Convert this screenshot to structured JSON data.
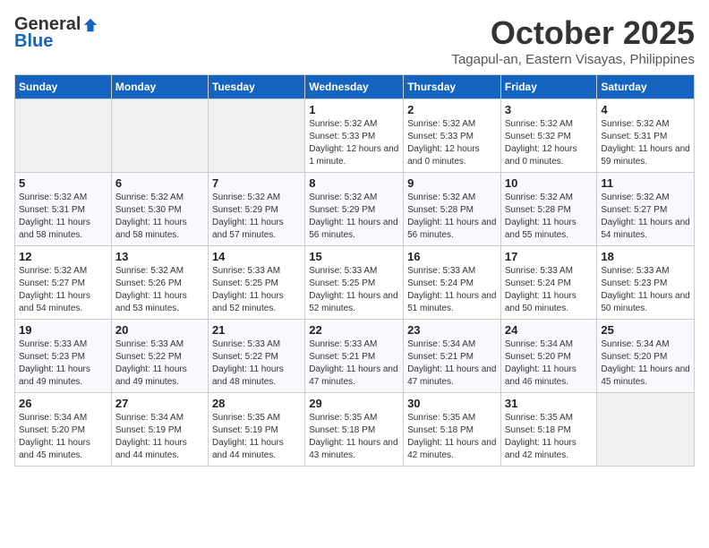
{
  "header": {
    "logo_general": "General",
    "logo_blue": "Blue",
    "month_title": "October 2025",
    "location": "Tagapul-an, Eastern Visayas, Philippines"
  },
  "columns": [
    "Sunday",
    "Monday",
    "Tuesday",
    "Wednesday",
    "Thursday",
    "Friday",
    "Saturday"
  ],
  "weeks": [
    [
      {
        "day": "",
        "info": ""
      },
      {
        "day": "",
        "info": ""
      },
      {
        "day": "",
        "info": ""
      },
      {
        "day": "1",
        "info": "Sunrise: 5:32 AM\nSunset: 5:33 PM\nDaylight: 12 hours and 1 minute."
      },
      {
        "day": "2",
        "info": "Sunrise: 5:32 AM\nSunset: 5:33 PM\nDaylight: 12 hours and 0 minutes."
      },
      {
        "day": "3",
        "info": "Sunrise: 5:32 AM\nSunset: 5:32 PM\nDaylight: 12 hours and 0 minutes."
      },
      {
        "day": "4",
        "info": "Sunrise: 5:32 AM\nSunset: 5:31 PM\nDaylight: 11 hours and 59 minutes."
      }
    ],
    [
      {
        "day": "5",
        "info": "Sunrise: 5:32 AM\nSunset: 5:31 PM\nDaylight: 11 hours and 58 minutes."
      },
      {
        "day": "6",
        "info": "Sunrise: 5:32 AM\nSunset: 5:30 PM\nDaylight: 11 hours and 58 minutes."
      },
      {
        "day": "7",
        "info": "Sunrise: 5:32 AM\nSunset: 5:29 PM\nDaylight: 11 hours and 57 minutes."
      },
      {
        "day": "8",
        "info": "Sunrise: 5:32 AM\nSunset: 5:29 PM\nDaylight: 11 hours and 56 minutes."
      },
      {
        "day": "9",
        "info": "Sunrise: 5:32 AM\nSunset: 5:28 PM\nDaylight: 11 hours and 56 minutes."
      },
      {
        "day": "10",
        "info": "Sunrise: 5:32 AM\nSunset: 5:28 PM\nDaylight: 11 hours and 55 minutes."
      },
      {
        "day": "11",
        "info": "Sunrise: 5:32 AM\nSunset: 5:27 PM\nDaylight: 11 hours and 54 minutes."
      }
    ],
    [
      {
        "day": "12",
        "info": "Sunrise: 5:32 AM\nSunset: 5:27 PM\nDaylight: 11 hours and 54 minutes."
      },
      {
        "day": "13",
        "info": "Sunrise: 5:32 AM\nSunset: 5:26 PM\nDaylight: 11 hours and 53 minutes."
      },
      {
        "day": "14",
        "info": "Sunrise: 5:33 AM\nSunset: 5:25 PM\nDaylight: 11 hours and 52 minutes."
      },
      {
        "day": "15",
        "info": "Sunrise: 5:33 AM\nSunset: 5:25 PM\nDaylight: 11 hours and 52 minutes."
      },
      {
        "day": "16",
        "info": "Sunrise: 5:33 AM\nSunset: 5:24 PM\nDaylight: 11 hours and 51 minutes."
      },
      {
        "day": "17",
        "info": "Sunrise: 5:33 AM\nSunset: 5:24 PM\nDaylight: 11 hours and 50 minutes."
      },
      {
        "day": "18",
        "info": "Sunrise: 5:33 AM\nSunset: 5:23 PM\nDaylight: 11 hours and 50 minutes."
      }
    ],
    [
      {
        "day": "19",
        "info": "Sunrise: 5:33 AM\nSunset: 5:23 PM\nDaylight: 11 hours and 49 minutes."
      },
      {
        "day": "20",
        "info": "Sunrise: 5:33 AM\nSunset: 5:22 PM\nDaylight: 11 hours and 49 minutes."
      },
      {
        "day": "21",
        "info": "Sunrise: 5:33 AM\nSunset: 5:22 PM\nDaylight: 11 hours and 48 minutes."
      },
      {
        "day": "22",
        "info": "Sunrise: 5:33 AM\nSunset: 5:21 PM\nDaylight: 11 hours and 47 minutes."
      },
      {
        "day": "23",
        "info": "Sunrise: 5:34 AM\nSunset: 5:21 PM\nDaylight: 11 hours and 47 minutes."
      },
      {
        "day": "24",
        "info": "Sunrise: 5:34 AM\nSunset: 5:20 PM\nDaylight: 11 hours and 46 minutes."
      },
      {
        "day": "25",
        "info": "Sunrise: 5:34 AM\nSunset: 5:20 PM\nDaylight: 11 hours and 45 minutes."
      }
    ],
    [
      {
        "day": "26",
        "info": "Sunrise: 5:34 AM\nSunset: 5:20 PM\nDaylight: 11 hours and 45 minutes."
      },
      {
        "day": "27",
        "info": "Sunrise: 5:34 AM\nSunset: 5:19 PM\nDaylight: 11 hours and 44 minutes."
      },
      {
        "day": "28",
        "info": "Sunrise: 5:35 AM\nSunset: 5:19 PM\nDaylight: 11 hours and 44 minutes."
      },
      {
        "day": "29",
        "info": "Sunrise: 5:35 AM\nSunset: 5:18 PM\nDaylight: 11 hours and 43 minutes."
      },
      {
        "day": "30",
        "info": "Sunrise: 5:35 AM\nSunset: 5:18 PM\nDaylight: 11 hours and 42 minutes."
      },
      {
        "day": "31",
        "info": "Sunrise: 5:35 AM\nSunset: 5:18 PM\nDaylight: 11 hours and 42 minutes."
      },
      {
        "day": "",
        "info": ""
      }
    ]
  ]
}
